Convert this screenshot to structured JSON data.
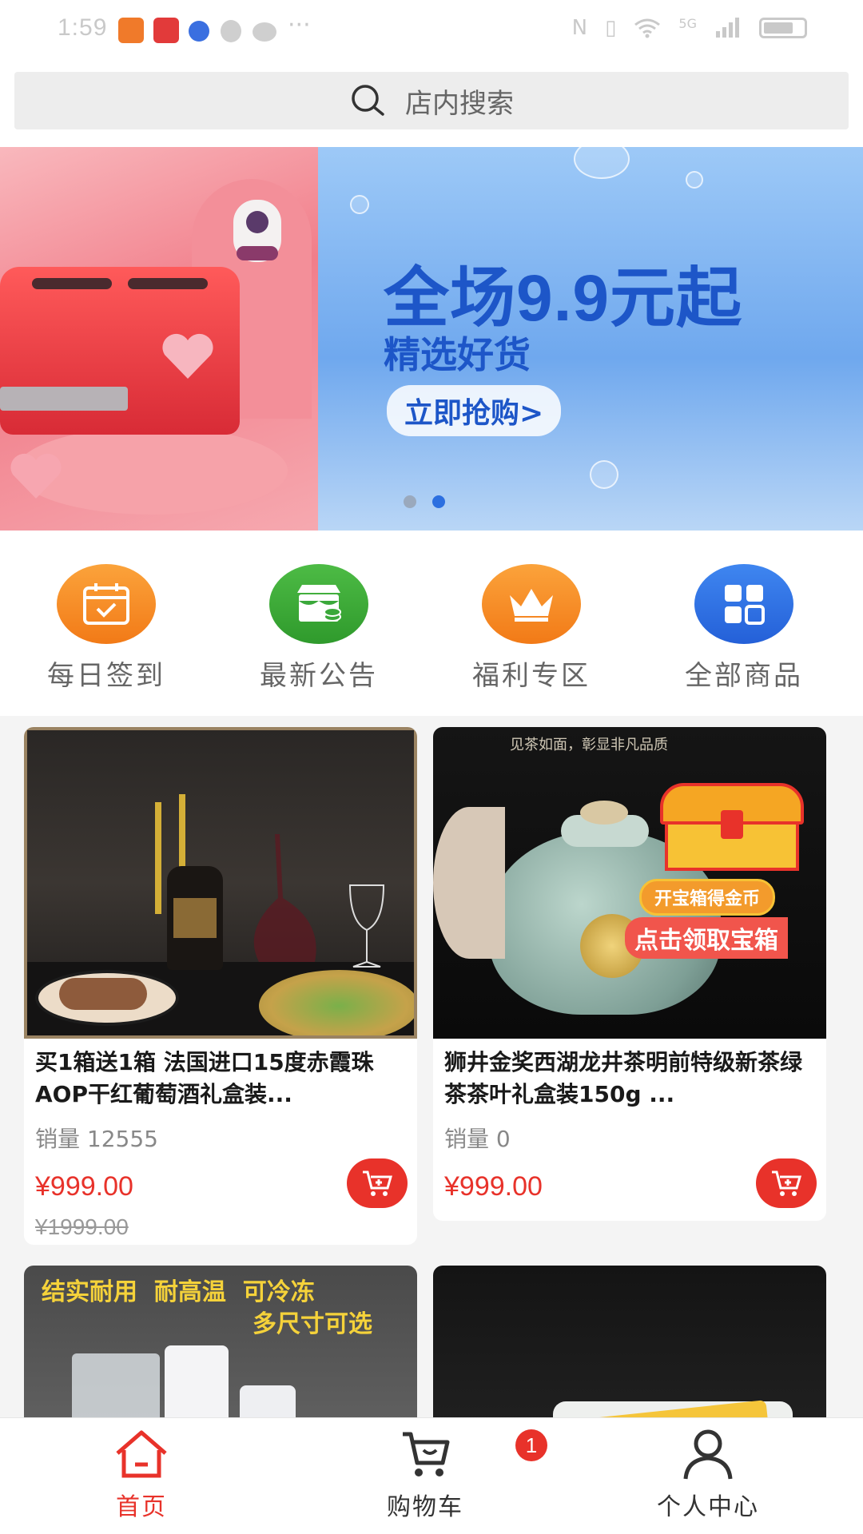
{
  "status_bar": {
    "time": "1:59",
    "network": "5G"
  },
  "search": {
    "placeholder": "店内搜索"
  },
  "banner": {
    "title": "全场9.9元起",
    "subtitle": "精选好货",
    "button_label": "立即抢购>",
    "slide_count": 2,
    "active_slide": 2
  },
  "quick_menu": [
    {
      "label": "每日签到",
      "icon": "calendar-check-icon",
      "color": "#f58a1f"
    },
    {
      "label": "最新公告",
      "icon": "store-icon",
      "color": "#3fa83a"
    },
    {
      "label": "福利专区",
      "icon": "crown-icon",
      "color": "#f58a1f"
    },
    {
      "label": "全部商品",
      "icon": "grid-icon",
      "color": "#2769e0"
    }
  ],
  "products": [
    {
      "title": "买1箱送1箱 法国进口15度赤霞珠AOP干红葡萄酒礼盒装...",
      "sales_label": "销量 12555",
      "price": "¥999.00",
      "original_price": "¥1999.00",
      "image": "wine-image"
    },
    {
      "title": "狮井金奖西湖龙井茶明前特级新茶绿茶茶叶礼盒装150g ...",
      "sales_label": "销量 0",
      "price": "¥999.00",
      "original_price": "",
      "image": "tea-jar-image",
      "image_caption": "见茶如面，彰显非凡品质",
      "promo_1": "开宝箱得金币",
      "promo_2": "点击领取宝箱"
    },
    {
      "image": "storage-bags-image",
      "image_text_1": "结实耐用  耐高温  可冷冻",
      "image_text_2": "多尺寸可选"
    },
    {
      "image": "food-box-image"
    }
  ],
  "tab_bar": {
    "tabs": [
      {
        "label": "首页",
        "icon": "home-icon",
        "active": true
      },
      {
        "label": "购物车",
        "icon": "cart-icon",
        "active": false,
        "badge": "1"
      },
      {
        "label": "个人中心",
        "icon": "user-icon",
        "active": false
      }
    ]
  },
  "colors": {
    "accent": "#e8322a",
    "banner_blue": "#1d56c8"
  }
}
